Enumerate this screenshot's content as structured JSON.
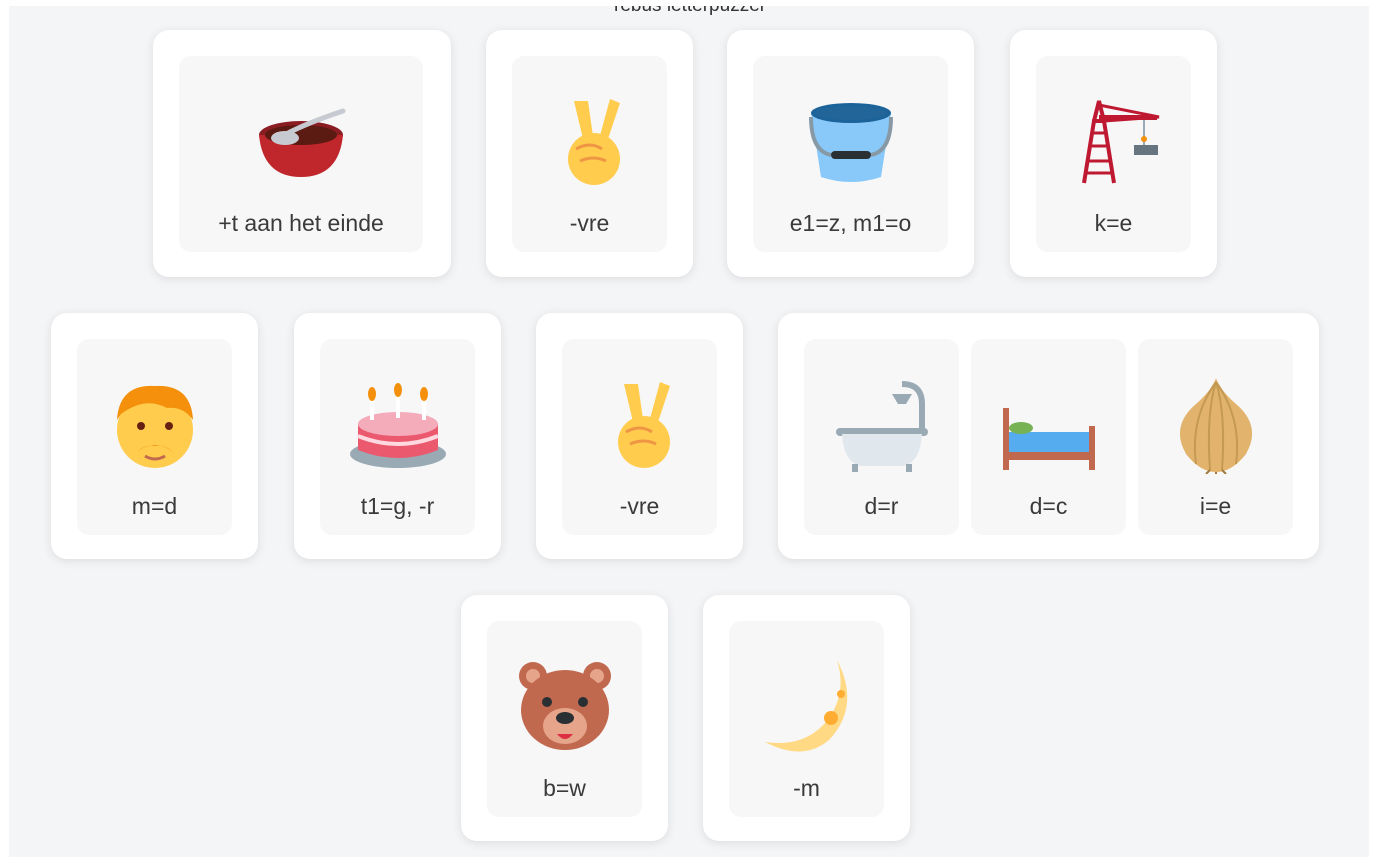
{
  "page": {
    "title": "rebus letterpuzzel"
  },
  "rows": [
    [
      {
        "items": [
          {
            "icon": "bowl-with-spoon-icon",
            "label": "+t aan het einde"
          }
        ]
      },
      {
        "items": [
          {
            "icon": "victory-hand-icon",
            "label": "-vre"
          }
        ]
      },
      {
        "items": [
          {
            "icon": "bucket-icon",
            "label": "e1=z, m1=o"
          }
        ]
      },
      {
        "items": [
          {
            "icon": "crane-icon",
            "label": "k=e"
          }
        ]
      }
    ],
    [
      {
        "items": [
          {
            "icon": "man-red-hair-icon",
            "label": "m=d"
          }
        ]
      },
      {
        "items": [
          {
            "icon": "birthday-cake-icon",
            "label": "t1=g, -r"
          }
        ]
      },
      {
        "items": [
          {
            "icon": "victory-hand-icon",
            "label": "-vre"
          }
        ]
      },
      {
        "items": [
          {
            "icon": "bathtub-icon",
            "label": "d=r"
          },
          {
            "icon": "bed-icon",
            "label": "d=c"
          },
          {
            "icon": "onion-icon",
            "label": "i=e"
          }
        ]
      }
    ],
    [
      {
        "items": [
          {
            "icon": "bear-face-icon",
            "label": "b=w"
          }
        ]
      },
      {
        "items": [
          {
            "icon": "crescent-moon-icon",
            "label": "-m"
          }
        ]
      }
    ]
  ]
}
